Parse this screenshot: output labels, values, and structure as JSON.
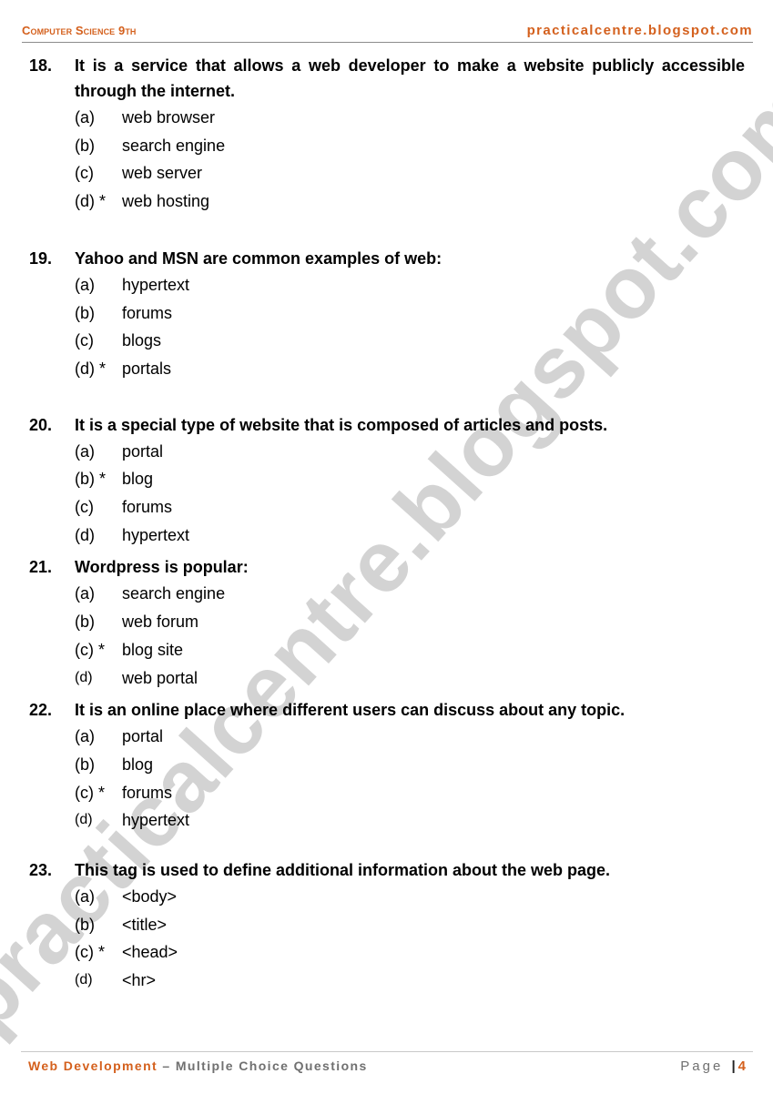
{
  "header": {
    "subject": "Computer Science 9th",
    "site": "practicalcentre.blogspot.com"
  },
  "watermark": "practicalcentre.blogspot.com",
  "questions": [
    {
      "number": "18.",
      "text": "It is a service that allows a web developer to make a website publicly accessible through the internet.",
      "options": [
        {
          "label": "(a)",
          "text": "web browser"
        },
        {
          "label": "(b)",
          "text": "search engine"
        },
        {
          "label": "(c)",
          "text": "web server"
        },
        {
          "label": "(d) *",
          "text": "web hosting"
        }
      ],
      "answer": "d"
    },
    {
      "number": "19.",
      "text": "Yahoo and MSN are common examples of web:",
      "options": [
        {
          "label": "(a)",
          "text": "hypertext"
        },
        {
          "label": "(b)",
          "text": "forums"
        },
        {
          "label": "(c)",
          "text": "blogs"
        },
        {
          "label": "(d) *",
          "text": "portals"
        }
      ],
      "answer": "d"
    },
    {
      "number": "20.",
      "text": "It is a special type of website that is composed of articles and posts.",
      "options": [
        {
          "label": "(a)",
          "text": "portal"
        },
        {
          "label": "(b) *",
          "text": "blog"
        },
        {
          "label": "(c)",
          "text": "forums"
        },
        {
          "label": "(d)",
          "text": "hypertext"
        }
      ],
      "answer": "b"
    },
    {
      "number": "21.",
      "text": "Wordpress is popular:",
      "options": [
        {
          "label": "(a)",
          "text": "search engine"
        },
        {
          "label": "(b)",
          "text": "web forum"
        },
        {
          "label": "(c) *",
          "text": "blog site"
        },
        {
          "label": "(d)",
          "text": "web portal"
        }
      ],
      "answer": "c"
    },
    {
      "number": "22.",
      "text": "It is an online place where different users can discuss about any topic.",
      "options": [
        {
          "label": "(a)",
          "text": "portal"
        },
        {
          "label": "(b)",
          "text": "blog"
        },
        {
          "label": "(c) *",
          "text": "forums"
        },
        {
          "label": "(d)",
          "text": "hypertext"
        }
      ],
      "answer": "c"
    },
    {
      "number": "23.",
      "text": "This tag is used to define additional information about the web page.",
      "options": [
        {
          "label": "(a)",
          "text": "<body>"
        },
        {
          "label": "(b)",
          "text": "<title>"
        },
        {
          "label": "(c) *",
          "text": "<head>"
        },
        {
          "label": "(d)",
          "text": "<hr>"
        }
      ],
      "answer": "c"
    }
  ],
  "footer": {
    "topic": "Web Development",
    "subtitle": " – Multiple Choice Questions",
    "page_label": "Page ",
    "separator": "|",
    "page_number": "4"
  },
  "colors": {
    "accent": "#d4601d",
    "watermark": "#d3d3d3",
    "footer_gray": "#707070"
  }
}
